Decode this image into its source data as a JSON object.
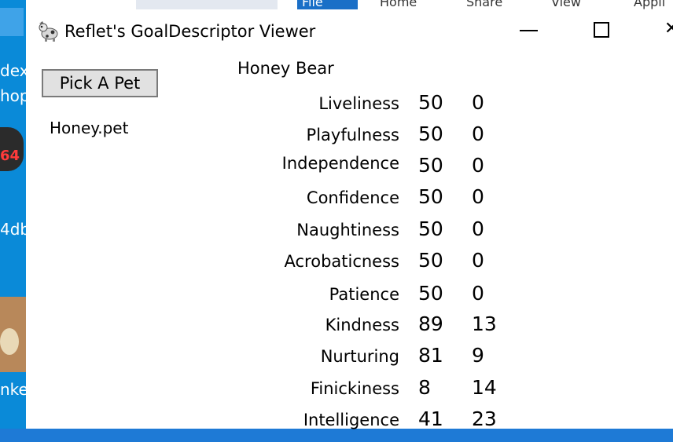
{
  "desktop": {
    "labels": [
      "dex",
      "hop",
      "4db",
      "nke"
    ],
    "badge": "64"
  },
  "background_window": {
    "file_tab": "File",
    "tabs": [
      "Home",
      "Share",
      "View",
      "Appli"
    ]
  },
  "window": {
    "title": "Reflet's GoalDescriptor Viewer",
    "pick_button": "Pick A Pet",
    "filename": "Honey.pet",
    "pet_name": "Honey Bear"
  },
  "traits": [
    {
      "name": "Liveliness",
      "value": "50",
      "delta": "0"
    },
    {
      "name": "Playfulness",
      "value": "50",
      "delta": "0"
    },
    {
      "name": "Independence",
      "value": "50",
      "delta": "0"
    },
    {
      "name": "Confidence",
      "value": "50",
      "delta": "0"
    },
    {
      "name": "Naughtiness",
      "value": "50",
      "delta": "0"
    },
    {
      "name": "Acrobaticness",
      "value": "50",
      "delta": "0"
    },
    {
      "name": "Patience",
      "value": "50",
      "delta": "0"
    },
    {
      "name": "Kindness",
      "value": "89",
      "delta": "13"
    },
    {
      "name": "Nurturing",
      "value": "81",
      "delta": "9"
    },
    {
      "name": "Finickiness",
      "value": "8",
      "delta": "14"
    },
    {
      "name": "Intelligence",
      "value": "41",
      "delta": "23"
    }
  ]
}
